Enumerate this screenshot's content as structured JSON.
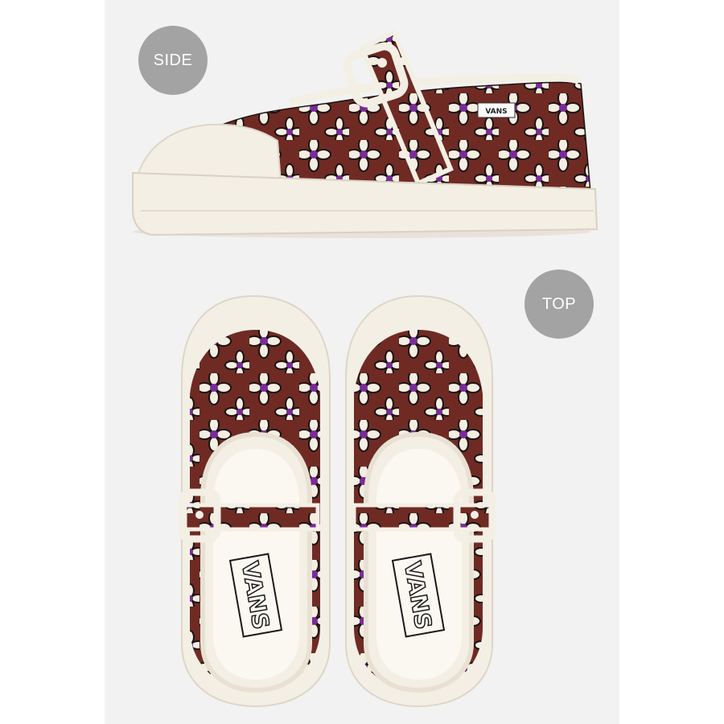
{
  "views": {
    "side_label": "SIDE",
    "top_label": "TOP"
  },
  "product": {
    "brand_tag": "VANS",
    "insole_logo": "VANS"
  },
  "colors": {
    "panel_bg": "#f2f2f2",
    "badge": "#a3a3a3",
    "upper_burgundy": "#6f2a24",
    "flower_cream": "#f3eee1",
    "flower_center_purple": "#7a2a9a",
    "sole_cream": "#f4efe4"
  }
}
